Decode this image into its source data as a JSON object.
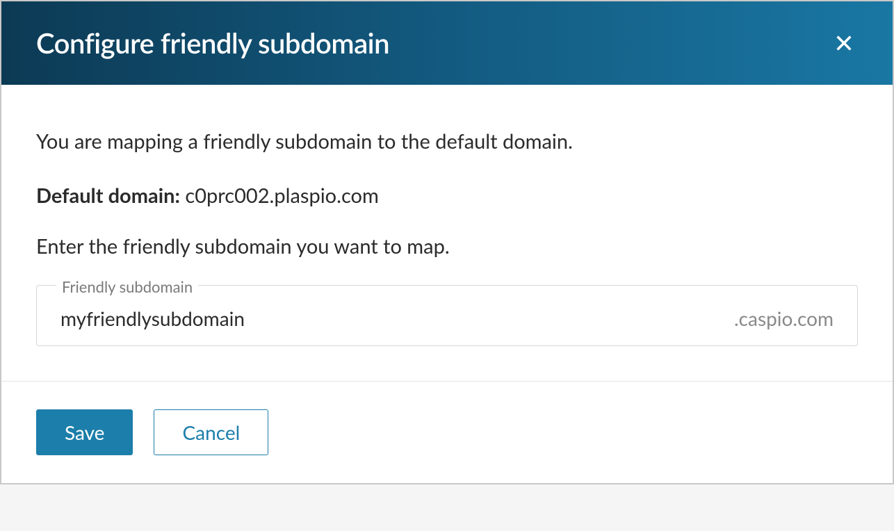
{
  "dialog": {
    "title": "Configure friendly subdomain",
    "intro": "You are mapping a friendly subdomain to the default domain.",
    "default_domain_label": "Default domain:",
    "default_domain_value": "c0prc002.plaspio.com",
    "enter_prompt": "Enter the friendly subdomain you want to map.",
    "field": {
      "label": "Friendly subdomain",
      "value": "myfriendlysubdomain",
      "suffix": ".caspio.com"
    },
    "buttons": {
      "save": "Save",
      "cancel": "Cancel"
    }
  }
}
